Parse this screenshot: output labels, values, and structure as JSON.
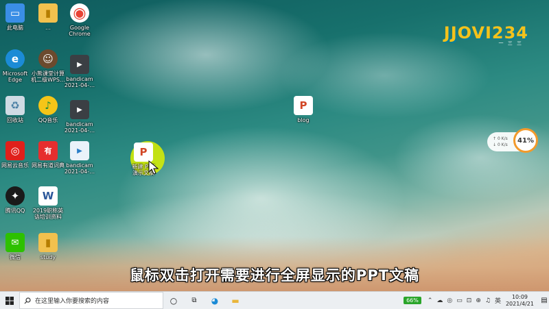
{
  "desktop": {
    "icons": [
      {
        "name": "this-pc",
        "label": "此电脑",
        "icon": "computer-icon",
        "color": "#3a8ee6",
        "glyph": "▭"
      },
      {
        "name": "folder",
        "label": "…",
        "icon": "folder-icon",
        "color": "#f2c14e",
        "glyph": "▮"
      },
      {
        "name": "google-chrome",
        "label": "Google\nChrome",
        "icon": "chrome-icon",
        "color": "#e94335",
        "glyph": "◉"
      },
      {
        "name": "microsoft-edge",
        "label": "Microsoft\nEdge",
        "icon": "edge-icon",
        "color": "#1b8bd6",
        "glyph": "e"
      },
      {
        "name": "xiaoxiong-app",
        "label": "小熊课堂计算\n机二级WPS…",
        "icon": "avatar-icon",
        "color": "#6b4a2e",
        "glyph": "☺"
      },
      {
        "name": "bandicam-1",
        "label": "bandicam\n2021-04-…",
        "icon": "video-file-icon",
        "color": "#3b3f44",
        "glyph": "▶"
      },
      {
        "name": "recycle-bin",
        "label": "回收站",
        "icon": "recycle-bin-icon",
        "color": "#9fb3c2",
        "glyph": "♻"
      },
      {
        "name": "qq-music",
        "label": "QQ音乐",
        "icon": "music-icon",
        "color": "#f5c518",
        "glyph": "♪"
      },
      {
        "name": "bandicam-2",
        "label": "bandicam\n2021-04-…",
        "icon": "video-file-icon",
        "color": "#3b3f44",
        "glyph": "▶"
      },
      {
        "name": "netease-music",
        "label": "网易云音乐",
        "icon": "netease-icon",
        "color": "#e0201b",
        "glyph": "◎"
      },
      {
        "name": "youdao-dict",
        "label": "网易有道词典",
        "icon": "youdao-icon",
        "color": "#e62e2e",
        "glyph": "有"
      },
      {
        "name": "bandicam-3",
        "label": "bandicam\n2021-04-…",
        "icon": "video-file-icon",
        "color": "#2a7ec8",
        "glyph": "▶"
      },
      {
        "name": "tencent-qq",
        "label": "腾讯QQ",
        "icon": "qq-icon",
        "color": "#1a1a1a",
        "glyph": "✦"
      },
      {
        "name": "word-doc",
        "label": "2019职称英\n语培训资料",
        "icon": "word-doc-icon",
        "color": "#2b579a",
        "glyph": "W"
      },
      {
        "name": "wechat",
        "label": "微信",
        "icon": "wechat-icon",
        "color": "#2dc100",
        "glyph": "✉"
      },
      {
        "name": "study-folder",
        "label": "study",
        "icon": "folder-icon",
        "color": "#f2c14e",
        "glyph": "▮"
      },
      {
        "name": "blog-file",
        "label": "blog",
        "icon": "ppt-file-icon",
        "color": "#d24726",
        "glyph": "P"
      },
      {
        "name": "ppt-file",
        "label": "新建 PPT\n演示文稿",
        "icon": "ppt-file-icon",
        "color": "#d24726",
        "glyph": "P"
      }
    ]
  },
  "watermark": {
    "logo": "JJOVI234",
    "tagline": "一 三 三"
  },
  "net_widget": {
    "up": "0  K/s",
    "down": "0  K/s",
    "percent": "41%"
  },
  "subtitle": "鼠标双击打开需要进行全屏显示的PPT文稿",
  "taskbar": {
    "search_placeholder": "在这里输入你要搜索的内容",
    "battery": "66%",
    "ime": "英",
    "time": "10:09",
    "date": "2021/4/21"
  }
}
